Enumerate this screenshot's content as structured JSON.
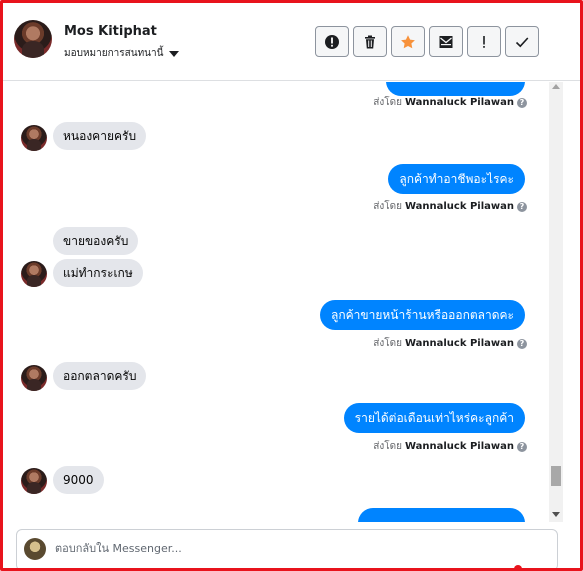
{
  "header": {
    "contact_name": "Mos Kitiphat",
    "assign_label": "มอบหมายการสนทนานี้",
    "actions": [
      {
        "name": "report-button",
        "icon": "alert-circle-icon"
      },
      {
        "name": "delete-button",
        "icon": "trash-icon"
      },
      {
        "name": "star-button",
        "icon": "star-icon",
        "color": "#f7923b"
      },
      {
        "name": "mark-unread-button",
        "icon": "envelope-icon"
      },
      {
        "name": "spam-button",
        "icon": "exclamation-icon"
      },
      {
        "name": "done-button",
        "icon": "check-icon"
      }
    ]
  },
  "sent_by": {
    "prefix": "ส่งโดย",
    "name": "Wannaluck Pilawan"
  },
  "messages": [
    {
      "dir": "in",
      "text": "หนองคายครับ"
    },
    {
      "dir": "out",
      "text": "ลูกค้าทำอาชีพอะไรคะ"
    },
    {
      "dir": "in",
      "text": "ขายของครับ"
    },
    {
      "dir": "in",
      "text": "แม่ทำกระเกษ"
    },
    {
      "dir": "out",
      "text": "ลูกค้าขายหน้าร้านหรือออกตลาดคะ"
    },
    {
      "dir": "in",
      "text": "ออกตลาดครับ"
    },
    {
      "dir": "out",
      "text": "รายได้ต่อเดือนเท่าไหร่คะลูกค้า"
    },
    {
      "dir": "in",
      "text": "9000"
    }
  ],
  "composer": {
    "placeholder": "ตอบกลับใน Messenger..."
  },
  "colors": {
    "outgoing_bubble": "#0084ff",
    "incoming_bubble": "#e4e6eb",
    "frame_border": "#e8131c"
  }
}
